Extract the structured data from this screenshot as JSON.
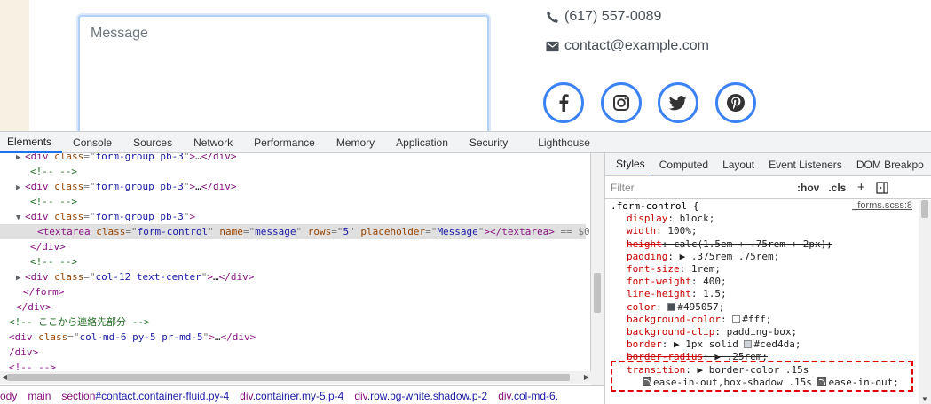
{
  "page": {
    "message_placeholder": "Message",
    "phone": "(617) 557-0089",
    "email": "contact@example.com",
    "social_icons": [
      "facebook-icon",
      "instagram-icon",
      "twitter-icon",
      "pinterest-icon"
    ],
    "accent_color": "#3b82f6"
  },
  "devtools": {
    "tabs": [
      "Elements",
      "Console",
      "Sources",
      "Network",
      "Performance",
      "Memory",
      "Application",
      "Security",
      "Lighthouse"
    ],
    "active_tab": "Elements",
    "dom_lines": [
      {
        "indent": 2,
        "parts": [
          [
            "tri",
            "▶"
          ],
          [
            "tag",
            "<div "
          ],
          [
            "attr",
            "class"
          ],
          [
            "eq",
            "=\""
          ],
          [
            "val",
            "form-group pb-3"
          ],
          [
            "eq",
            "\""
          ],
          [
            "tag",
            ">"
          ],
          [
            "txt",
            "…"
          ],
          [
            "tag",
            "</div>"
          ]
        ]
      },
      {
        "indent": 3,
        "parts": [
          [
            "cmt",
            "<!-- -->"
          ]
        ]
      },
      {
        "indent": 2,
        "parts": [
          [
            "tri",
            "▶"
          ],
          [
            "tag",
            "<div "
          ],
          [
            "attr",
            "class"
          ],
          [
            "eq",
            "=\""
          ],
          [
            "val",
            "form-group pb-3"
          ],
          [
            "eq",
            "\""
          ],
          [
            "tag",
            ">"
          ],
          [
            "txt",
            "…"
          ],
          [
            "tag",
            "</div>"
          ]
        ]
      },
      {
        "indent": 3,
        "parts": [
          [
            "cmt",
            "<!-- -->"
          ]
        ]
      },
      {
        "indent": 2,
        "parts": [
          [
            "tri",
            "▼"
          ],
          [
            "tag",
            "<div "
          ],
          [
            "attr",
            "class"
          ],
          [
            "eq",
            "=\""
          ],
          [
            "val",
            "form-group pb-3"
          ],
          [
            "eq",
            "\""
          ],
          [
            "tag",
            ">"
          ]
        ]
      },
      {
        "indent": 4,
        "selected": true,
        "parts": [
          [
            "tag",
            "<textarea "
          ],
          [
            "attr",
            "class"
          ],
          [
            "eq",
            "=\""
          ],
          [
            "val",
            "form-control"
          ],
          [
            "eq",
            "\" "
          ],
          [
            "attr",
            "name"
          ],
          [
            "eq",
            "=\""
          ],
          [
            "val",
            "message"
          ],
          [
            "eq",
            "\" "
          ],
          [
            "attr",
            "rows"
          ],
          [
            "eq",
            "=\""
          ],
          [
            "val",
            "5"
          ],
          [
            "eq",
            "\" "
          ],
          [
            "attr",
            "placeholder"
          ],
          [
            "eq",
            "=\""
          ],
          [
            "val",
            "Message"
          ],
          [
            "eq",
            "\""
          ],
          [
            "tag",
            "></textarea>"
          ],
          [
            "eq",
            " == $0"
          ]
        ]
      },
      {
        "indent": 3,
        "parts": [
          [
            "tag",
            "</div>"
          ]
        ]
      },
      {
        "indent": 3,
        "parts": [
          [
            "cmt",
            "<!-- -->"
          ]
        ]
      },
      {
        "indent": 2,
        "parts": [
          [
            "tri",
            "▶"
          ],
          [
            "tag",
            "<div "
          ],
          [
            "attr",
            "class"
          ],
          [
            "eq",
            "=\""
          ],
          [
            "val",
            "col-12 text-center"
          ],
          [
            "eq",
            "\""
          ],
          [
            "tag",
            ">"
          ],
          [
            "txt",
            "…"
          ],
          [
            "tag",
            "</div>"
          ]
        ]
      },
      {
        "indent": 2,
        "parts": [
          [
            "tag",
            "</form>"
          ]
        ]
      },
      {
        "indent": 1,
        "parts": [
          [
            "tag",
            "</div>"
          ]
        ]
      },
      {
        "indent": 0,
        "parts": [
          [
            "cmt",
            "<!-- ここから連絡先部分 -->"
          ]
        ]
      },
      {
        "indent": 0,
        "parts": [
          [
            "tag",
            "<div "
          ],
          [
            "attr",
            "class"
          ],
          [
            "eq",
            "=\""
          ],
          [
            "val",
            "col-md-6 py-5 pr-md-5"
          ],
          [
            "eq",
            "\""
          ],
          [
            "tag",
            ">"
          ],
          [
            "txt",
            "…"
          ],
          [
            "tag",
            "</div>"
          ]
        ]
      },
      {
        "indent": 0,
        "parts": [
          [
            "tag",
            "/div>"
          ]
        ]
      },
      {
        "indent": 0,
        "parts": [
          [
            "tag",
            "<!-- -->"
          ]
        ]
      }
    ],
    "breadcrumb": [
      {
        "tag": "ody",
        "cls": ""
      },
      {
        "tag": "main",
        "cls": ""
      },
      {
        "tag": "section",
        "cls": "#contact.container-fluid.py-4"
      },
      {
        "tag": "div",
        "cls": ".container.my-5.p-4"
      },
      {
        "tag": "div",
        "cls": ".row.bg-white.shadow.p-2"
      },
      {
        "tag": "div",
        "cls": ".col-md-6."
      }
    ],
    "styles": {
      "tabs": [
        "Styles",
        "Computed",
        "Layout",
        "Event Listeners",
        "DOM Breakpo"
      ],
      "active_tab": "Styles",
      "filter_placeholder": "Filter",
      "hov_label": ":hov",
      "cls_label": ".cls",
      "plus_label": "+",
      "selector": ".form-control {",
      "source": "_forms.scss:8",
      "declarations": [
        {
          "prop": "display",
          "value": "block;"
        },
        {
          "prop": "width",
          "value": "100%;"
        },
        {
          "prop": "height",
          "value": "calc(1.5em + .75rem + 2px);",
          "struck": true
        },
        {
          "prop": "padding",
          "value": "▶ .375rem .75rem;"
        },
        {
          "prop": "font-size",
          "value": "1rem;"
        },
        {
          "prop": "font-weight",
          "value": "400;"
        },
        {
          "prop": "line-height",
          "value": "1.5;"
        },
        {
          "prop": "color",
          "value": "#495057;",
          "swatch": "#495057"
        },
        {
          "prop": "background-color",
          "value": "#fff;",
          "swatch": "#ffffff"
        },
        {
          "prop": "background-clip",
          "value": "padding-box;"
        },
        {
          "prop": "border",
          "value": "▶ 1px solid ",
          "value2": "#ced4da;",
          "swatch2": "#ced4da"
        },
        {
          "prop": "border-radius",
          "value": "▶ .25rem;",
          "struck": true
        },
        {
          "prop": "transition",
          "value": "▶ border-color .15s"
        }
      ],
      "transition_cont": {
        "part1": "ease-in-out,box-shadow .15s",
        "part2": "ease-in-out;"
      }
    }
  }
}
